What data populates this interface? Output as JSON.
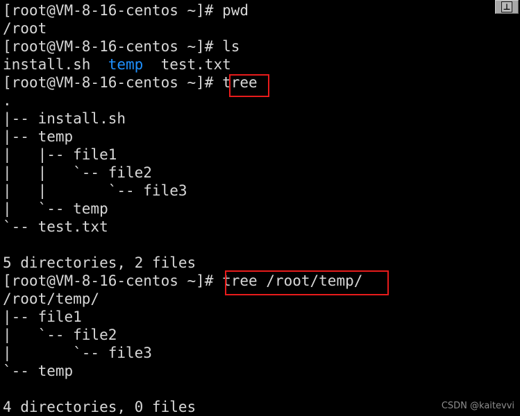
{
  "window": {
    "background_color": "#000000",
    "foreground_color": "#d8d8d8",
    "directory_color": "#1e90ff",
    "annotation_color": "#e81b1b",
    "pin_button": {
      "name": "pin-window-button",
      "glyph": "⊥"
    }
  },
  "prompt": "[root@VM-8-16-centos ~]# ",
  "commands": {
    "pwd": "pwd",
    "ls": "ls",
    "tree": "tree",
    "tree_path": "tree /root/temp/"
  },
  "lines": [
    {
      "id": "l01",
      "type": "prompt",
      "prompt": "[root@VM-8-16-centos ~]# ",
      "command": "pwd"
    },
    {
      "id": "l02",
      "type": "output",
      "text": "/root"
    },
    {
      "id": "l03",
      "type": "prompt",
      "prompt": "[root@VM-8-16-centos ~]# ",
      "command": "ls"
    },
    {
      "id": "l04",
      "type": "ls",
      "segments": [
        {
          "text": "install.sh  ",
          "color": "default"
        },
        {
          "text": "temp",
          "color": "dir"
        },
        {
          "text": "  test.txt",
          "color": "default"
        }
      ]
    },
    {
      "id": "l05",
      "type": "prompt",
      "prompt": "[root@VM-8-16-centos ~]# ",
      "command": "tree",
      "highlighted": true
    },
    {
      "id": "l06",
      "type": "output",
      "text": "."
    },
    {
      "id": "l07",
      "type": "output",
      "text": "|-- install.sh"
    },
    {
      "id": "l08",
      "type": "output",
      "text": "|-- temp"
    },
    {
      "id": "l09",
      "type": "output",
      "text": "|   |-- file1"
    },
    {
      "id": "l10",
      "type": "output",
      "text": "|   |   `-- file2"
    },
    {
      "id": "l11",
      "type": "output",
      "text": "|   |       `-- file3"
    },
    {
      "id": "l12",
      "type": "output",
      "text": "|   `-- temp"
    },
    {
      "id": "l13",
      "type": "output",
      "text": "`-- test.txt"
    },
    {
      "id": "l14",
      "type": "blank",
      "text": " "
    },
    {
      "id": "l15",
      "type": "output",
      "text": "5 directories, 2 files"
    },
    {
      "id": "l16",
      "type": "prompt",
      "prompt": "[root@VM-8-16-centos ~]# ",
      "command": "tree /root/temp/",
      "highlighted": true
    },
    {
      "id": "l17",
      "type": "output",
      "text": "/root/temp/"
    },
    {
      "id": "l18",
      "type": "output",
      "text": "|-- file1"
    },
    {
      "id": "l19",
      "type": "output",
      "text": "|   `-- file2"
    },
    {
      "id": "l20",
      "type": "output",
      "text": "|       `-- file3"
    },
    {
      "id": "l21",
      "type": "output",
      "text": "`-- temp"
    },
    {
      "id": "l22",
      "type": "blank",
      "text": " "
    },
    {
      "id": "l23",
      "type": "output",
      "text": "4 directories, 0 files"
    }
  ],
  "summaries": {
    "first_tree": "5 directories, 2 files",
    "second_tree": "4 directories, 0 files"
  },
  "watermark": "CSDN @kaitevvi"
}
